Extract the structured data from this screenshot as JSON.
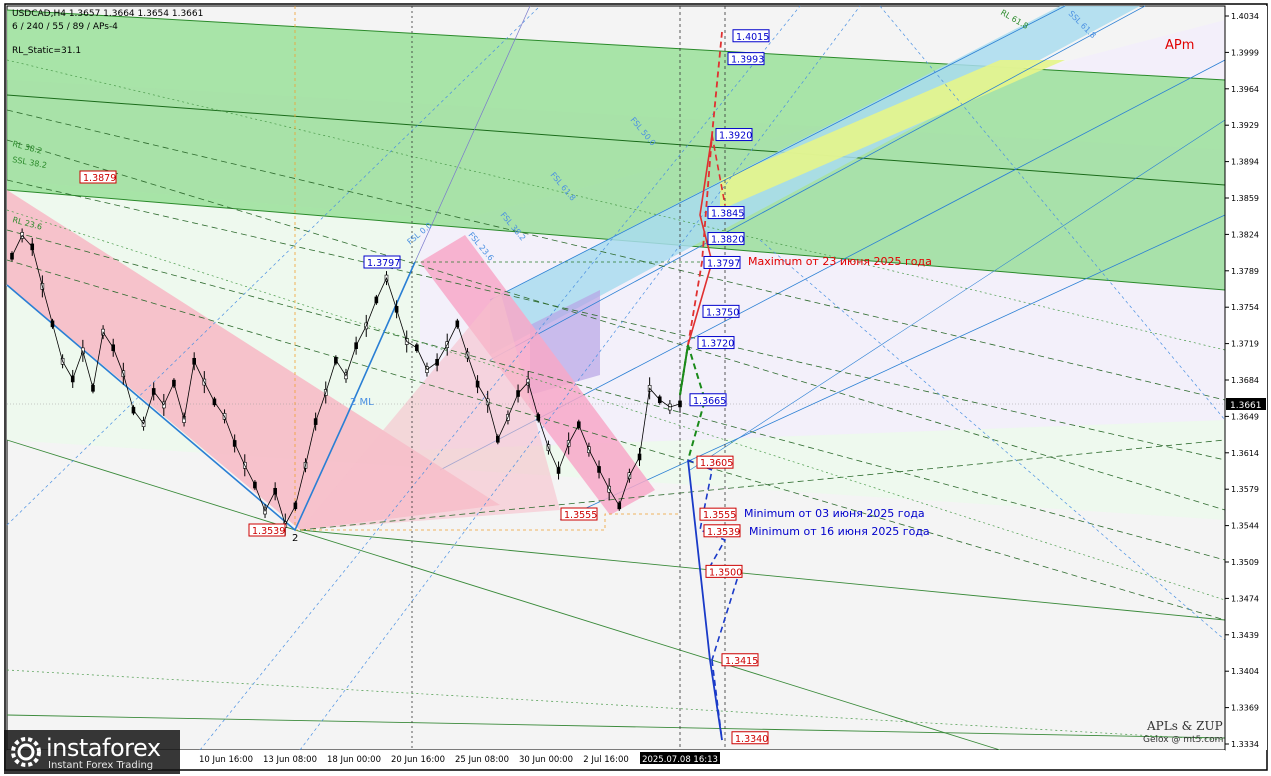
{
  "header": {
    "symbol_line": "USDCAD,H4  1.3657 1.3664 1.3654 1.3661",
    "params_line": "6 / 240 / 55 / 89 / APs-4",
    "static_line": "RL_Static=31.1"
  },
  "chart_data": {
    "type": "line",
    "title": "USDCAD,H4",
    "ylim": [
      1.332,
      1.404
    ],
    "price_axis_ticks": [
      "1.4034",
      "1.3999",
      "1.3964",
      "1.3929",
      "1.3894",
      "1.3859",
      "1.3824",
      "1.3789",
      "1.3754",
      "1.3719",
      "1.3684",
      "1.3649",
      "1.3614",
      "1.3579",
      "1.3544",
      "1.3509",
      "1.3474",
      "1.3439",
      "1.3404",
      "1.3369",
      "1.3334"
    ],
    "current_price": "1.3661",
    "time_axis_labels": [
      "10 Jun 16:00",
      "13 Jun 08:00",
      "18 Jun 00:00",
      "20 Jun 16:00",
      "25 Jun 08:00",
      "30 Jun 00:00",
      "2 Jul 16:00",
      "2025.07.08 16:13"
    ],
    "price_markers": [
      {
        "label": "1.4015",
        "color": "#0000cc"
      },
      {
        "label": "1.3993",
        "color": "#0000cc"
      },
      {
        "label": "1.3920",
        "color": "#0000cc"
      },
      {
        "label": "1.3845",
        "color": "#0000cc"
      },
      {
        "label": "1.3820",
        "color": "#0000cc"
      },
      {
        "label": "1.3797",
        "color": "#0000cc"
      },
      {
        "label": "1.3750",
        "color": "#0000cc"
      },
      {
        "label": "1.3720",
        "color": "#0000cc"
      },
      {
        "label": "1.3665",
        "color": "#0000cc"
      },
      {
        "label": "1.3605",
        "color": "#cc0000"
      },
      {
        "label": "1.3555",
        "color": "#cc0000"
      },
      {
        "label": "1.3539",
        "color": "#cc0000"
      },
      {
        "label": "1.3500",
        "color": "#cc0000"
      },
      {
        "label": "1.3415",
        "color": "#cc0000"
      },
      {
        "label": "1.3340",
        "color": "#cc0000"
      }
    ],
    "chart_markers": [
      {
        "label": "1.3879",
        "color": "#cc0000"
      },
      {
        "label": "1.3797",
        "color": "#0000cc"
      },
      {
        "label": "1.3539",
        "color": "#cc0000"
      },
      {
        "label": "1.3555",
        "color": "#cc0000"
      }
    ],
    "annotations": [
      {
        "text": "Maximum от 23 июня 2025 года",
        "color": "#e00000"
      },
      {
        "text": "Minimum от 03 июня 2025 года",
        "color": "#0000cc"
      },
      {
        "text": "Minimum от 16 июня 2025 года",
        "color": "#0000cc"
      },
      {
        "text": "2 ML",
        "color": "#4a90e2"
      },
      {
        "text": "2",
        "color": "#000000"
      }
    ],
    "level_labels": [
      "RL 38.2",
      "SSL 38.2",
      "RL 23.6",
      "FSL 0.0",
      "FSL 23.6",
      "FSL 38.2",
      "FSL 50.0",
      "FSL 61.8",
      "RL 61.8",
      "SSL 61.8"
    ],
    "series": [
      {
        "name": "price",
        "values": [
          1.3803,
          1.3823,
          1.3812,
          1.3774,
          1.3738,
          1.3702,
          1.3685,
          1.3712,
          1.3676,
          1.373,
          1.3715,
          1.369,
          1.3655,
          1.3642,
          1.3673,
          1.366,
          1.3681,
          1.3646,
          1.3702,
          1.3682,
          1.3663,
          1.3649,
          1.3623,
          1.3602,
          1.3583,
          1.3558,
          1.3577,
          1.3545,
          1.3563,
          1.3602,
          1.3644,
          1.3672,
          1.3703,
          1.3688,
          1.3717,
          1.3736,
          1.3761,
          1.3782,
          1.3752,
          1.3721,
          1.3715,
          1.3694,
          1.3701,
          1.3718,
          1.3738,
          1.3708,
          1.368,
          1.3663,
          1.3627,
          1.3648,
          1.3671,
          1.3682,
          1.3648,
          1.3619,
          1.3597,
          1.3623,
          1.3641,
          1.3617,
          1.3598,
          1.3579,
          1.3563,
          1.3592,
          1.361,
          1.3676,
          1.3665,
          1.3658,
          1.3661
        ]
      }
    ]
  },
  "labels": {
    "apm": "APm",
    "credit_title": "APLs & ZUP",
    "credit_sub": "Gelox @ mt5.com"
  },
  "logo": {
    "main": "instaforex",
    "sub": "Instant Forex Trading"
  }
}
